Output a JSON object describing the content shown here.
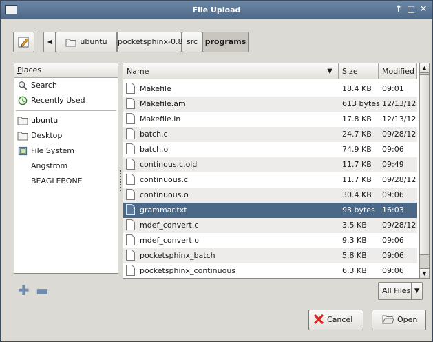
{
  "window": {
    "title": "File Upload",
    "controls": [
      "↑",
      "□",
      "✕"
    ]
  },
  "path_bar": {
    "crumbs": [
      "ubuntu",
      "pocketsphinx-0.8",
      "src",
      "programs"
    ],
    "active_index": 3
  },
  "places": {
    "header_mnemonic": "P",
    "header_rest": "laces",
    "items": [
      {
        "label": "Search",
        "icon": "search-icon"
      },
      {
        "label": "Recently Used",
        "icon": "recent-icon"
      },
      {
        "label": "ubuntu",
        "icon": "home-folder-icon"
      },
      {
        "label": "Desktop",
        "icon": "desktop-folder-icon"
      },
      {
        "label": "File System",
        "icon": "filesystem-icon"
      },
      {
        "label": "Angstrom",
        "icon": ""
      },
      {
        "label": "BEAGLEBONE",
        "icon": ""
      }
    ]
  },
  "files": {
    "columns": {
      "name": "Name",
      "size": "Size",
      "modified": "Modified"
    },
    "rows": [
      {
        "name": "Makefile",
        "size": "18.4 KB",
        "modified": "09:01"
      },
      {
        "name": "Makefile.am",
        "size": "613 bytes",
        "modified": "12/13/12"
      },
      {
        "name": "Makefile.in",
        "size": "17.8 KB",
        "modified": "12/13/12"
      },
      {
        "name": "batch.c",
        "size": "24.7 KB",
        "modified": "09/28/12"
      },
      {
        "name": "batch.o",
        "size": "74.9 KB",
        "modified": "09:06"
      },
      {
        "name": "continous.c.old",
        "size": "11.7 KB",
        "modified": "09:49"
      },
      {
        "name": "continuous.c",
        "size": "11.7 KB",
        "modified": "09/28/12"
      },
      {
        "name": "continuous.o",
        "size": "30.4 KB",
        "modified": "09:06"
      },
      {
        "name": "grammar.txt",
        "size": "93 bytes",
        "modified": "16:03",
        "selected": true
      },
      {
        "name": "mdef_convert.c",
        "size": "3.5 KB",
        "modified": "09/28/12"
      },
      {
        "name": "mdef_convert.o",
        "size": "9.3 KB",
        "modified": "09:06"
      },
      {
        "name": "pocketsphinx_batch",
        "size": "5.8 KB",
        "modified": "09:06"
      },
      {
        "name": "pocketsphinx_continuous",
        "size": "6.3 KB",
        "modified": "09:06"
      },
      {
        "name": "",
        "size": "",
        "modified": ""
      }
    ]
  },
  "filter": {
    "selected": "All Files"
  },
  "buttons": {
    "cancel_mnemonic": "C",
    "cancel_rest": "ancel",
    "open_mnemonic": "O",
    "open_rest": "pen"
  },
  "colors": {
    "selection": "#4b6887",
    "titlebar": "#5a7596",
    "window_bg": "#dcdad5"
  }
}
